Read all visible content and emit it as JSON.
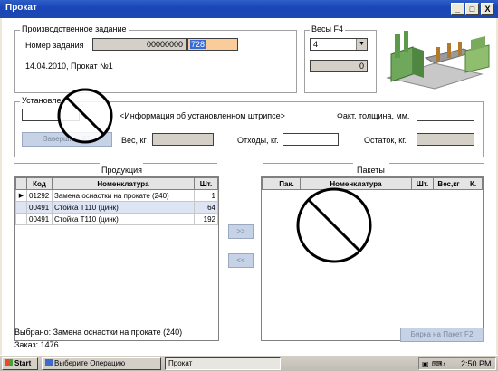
{
  "window": {
    "title": "Прокат",
    "minimize": "_",
    "maximize": "□",
    "close": "X"
  },
  "task": {
    "group_label": "Производственное задание",
    "number_label": "Номер задания",
    "number_value": "00000000",
    "number_input": "728",
    "date_line": "14.04.2010, Прокат №1"
  },
  "scales": {
    "group_label": "Весы  F4",
    "selected": "4",
    "weight": "0"
  },
  "strip": {
    "group_label": "Установлен",
    "info_text": "<Информация об установленном штрипсе>",
    "thickness_label": "Факт. толщина, мм.",
    "finish_button": "Завершить      F1",
    "weight_label": "Вес, кг",
    "waste_label": "Отходы, кг.",
    "rest_label": "Остаток, кг."
  },
  "products": {
    "label": "Продукция",
    "columns": [
      "Код",
      "Номенклатура",
      "Шт."
    ],
    "rows": [
      {
        "code": "01292",
        "name": "Замена оснастки на прокате (240)",
        "qty": "1"
      },
      {
        "code": "00491",
        "name": "Стойка Т110 (цинк)",
        "qty": "64"
      },
      {
        "code": "00491",
        "name": "Стойка Т110 (цинк)",
        "qty": "192"
      }
    ]
  },
  "packages": {
    "label": "Пакеты",
    "columns": [
      "Пак.",
      "Номенклатура",
      "Шт.",
      "Вес,кг",
      "К."
    ]
  },
  "transfer": {
    "right": ">>",
    "left": "<<"
  },
  "footer": {
    "selected": "Выбрано: Замена оснастки на прокате (240)",
    "order": "Заказ: 1476",
    "tag_button": "Бирка на Пакет   F2"
  },
  "taskbar": {
    "start": "Start",
    "task1": "Выберите Операцию",
    "task2": "Прокат",
    "clock": "2:50 PM"
  }
}
